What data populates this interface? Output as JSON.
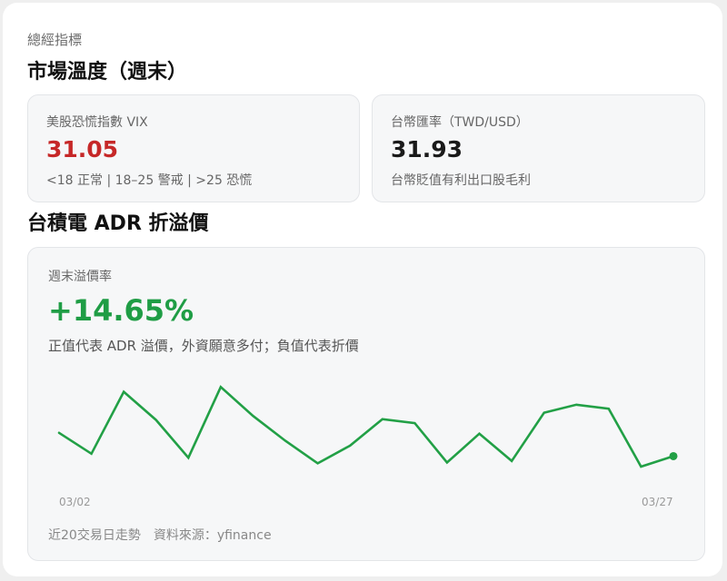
{
  "header": {
    "kicker": "總經指標",
    "title": "市場溫度（週末）"
  },
  "vix_card": {
    "label": "美股恐慌指數 VIX",
    "value": "31.05",
    "value_color": "#c62828",
    "note": "<18 正常 | 18–25 警戒 | >25 恐慌"
  },
  "twd_card": {
    "label": "台幣匯率（TWD/USD）",
    "value": "31.93",
    "note": "台幣貶值有利出口股毛利"
  },
  "adr_section": {
    "title": "台積電 ADR 折溢價",
    "card_label": "週末溢價率",
    "value": "+14.65%",
    "value_color": "#1f9d45",
    "note": "正值代表 ADR 溢價，外資願意多付；負值代表折價",
    "footer": "近20交易日走勢　資料來源：yfinance"
  },
  "chart_data": {
    "type": "line",
    "x_start_label": "03/02",
    "x_end_label": "03/27",
    "values": [
      10.8,
      8.2,
      15.9,
      12.4,
      7.7,
      16.5,
      12.9,
      9.8,
      7.0,
      9.2,
      12.5,
      12.0,
      7.1,
      10.7,
      7.3,
      13.3,
      14.3,
      13.8,
      6.6,
      7.9
    ],
    "line_color": "#22a046",
    "ylim": [
      4,
      18
    ],
    "grid": false
  }
}
